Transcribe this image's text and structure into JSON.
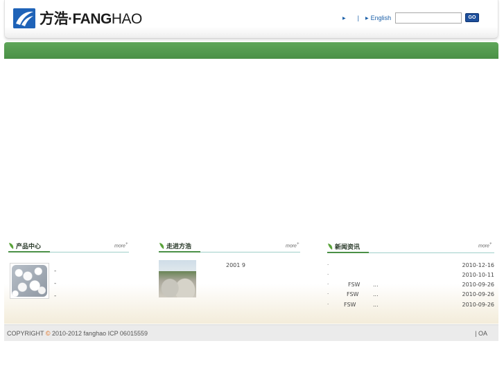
{
  "header": {
    "logo_text_cn": "方浩·",
    "logo_text_bold": "FANG",
    "logo_text_light": "HAO",
    "links": [
      {
        "label": ""
      },
      {
        "label": "English"
      }
    ],
    "search": {
      "value": "",
      "placeholder": ""
    },
    "go_label": "GO"
  },
  "sections": {
    "products": {
      "title": "产品中心",
      "more": "more",
      "items": [
        "-",
        "-",
        "-"
      ]
    },
    "about": {
      "title": "走进方浩",
      "more": "more",
      "text": "2001 9"
    },
    "news": {
      "title": "新闻资讯",
      "more": "more",
      "items": [
        {
          "bullet": "·",
          "text": "",
          "dots": "",
          "date": "2010-12-16"
        },
        {
          "bullet": "·",
          "text": "",
          "dots": "",
          "date": "2010-10-11"
        },
        {
          "bullet": "·",
          "text": "FSW",
          "dots": "...",
          "date": "2010-09-26"
        },
        {
          "bullet": "·",
          "text": "FSW",
          "dots": "...",
          "date": "2010-09-26"
        },
        {
          "bullet": "·",
          "text": "FSW",
          "dots": "...",
          "date": "2010-09-26"
        }
      ]
    }
  },
  "footer": {
    "copyright_prefix": "COPYRIGHT",
    "copyright_symbol": "©",
    "copyright_rest": "2010-2012 fanghao  ICP 06015559",
    "oa": "| OA"
  },
  "colors": {
    "brand_blue": "#1f63b8",
    "nav_green": "#4a9046",
    "link_blue": "#1a5fa8"
  }
}
